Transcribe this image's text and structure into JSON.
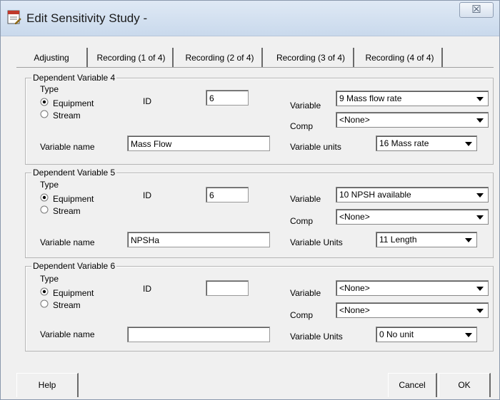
{
  "window": {
    "title": "Edit Sensitivity Study -",
    "close_glyph": "☒"
  },
  "tabs": [
    {
      "label": "Adjusting"
    },
    {
      "label": "Recording (1 of 4)"
    },
    {
      "label": "Recording (2 of 4)"
    },
    {
      "label": "Recording (3 of 4)"
    },
    {
      "label": "Recording (4 of 4)"
    }
  ],
  "active_tab": "Recording (2 of 4)",
  "groups": [
    {
      "title": "Dependent Variable 4",
      "type_label": "Type",
      "radio_equipment": "Equipment",
      "radio_stream": "Stream",
      "selected_type": "Equipment",
      "id_label": "ID",
      "id_value": "6",
      "name_label": "Variable name",
      "name_value": "Mass Flow",
      "variable_label": "Variable",
      "variable_value": "9 Mass flow rate",
      "comp_label": "Comp",
      "comp_value": "<None>",
      "units_label": "Variable units",
      "units_value": "16 Mass rate"
    },
    {
      "title": "Dependent Variable 5",
      "type_label": "Type",
      "radio_equipment": "Equipment",
      "radio_stream": "Stream",
      "selected_type": "Equipment",
      "id_label": "ID",
      "id_value": "6",
      "name_label": "Variable name",
      "name_value": "NPSHa",
      "variable_label": "Variable",
      "variable_value": "10 NPSH available",
      "comp_label": "Comp",
      "comp_value": "<None>",
      "units_label": "Variable Units",
      "units_value": "11 Length"
    },
    {
      "title": "Dependent Variable 6",
      "type_label": "Type",
      "radio_equipment": "Equipment",
      "radio_stream": "Stream",
      "selected_type": "Equipment",
      "id_label": "ID",
      "id_value": "",
      "name_label": "Variable name",
      "name_value": "",
      "variable_label": "Variable",
      "variable_value": "<None>",
      "comp_label": "Comp",
      "comp_value": "<None>",
      "units_label": "Variable Units",
      "units_value": "0  No unit"
    }
  ],
  "buttons": {
    "help": "Help",
    "cancel": "Cancel",
    "ok": "OK"
  },
  "icons": {
    "app": "study-document-icon",
    "close": "close-icon",
    "dropdown": "chevron-down-icon"
  }
}
